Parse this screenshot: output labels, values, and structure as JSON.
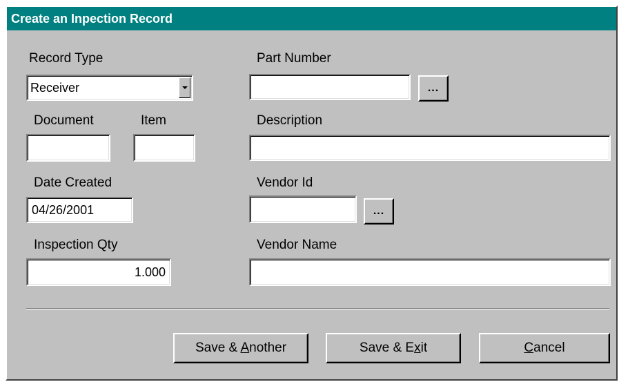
{
  "dialog": {
    "title": "Create an Inpection Record"
  },
  "labels": {
    "record_type": "Record Type",
    "part_number": "Part Number",
    "document": "Document",
    "item": "Item",
    "description": "Description",
    "date_created": "Date Created",
    "vendor_id": "Vendor Id",
    "inspection_qty": "Inspection Qty",
    "vendor_name": "Vendor Name"
  },
  "fields": {
    "record_type": {
      "value": "Receiver"
    },
    "part_number": {
      "value": ""
    },
    "document": {
      "value": ""
    },
    "item": {
      "value": ""
    },
    "description": {
      "value": ""
    },
    "date_created": {
      "value": "04/26/2001"
    },
    "vendor_id": {
      "value": ""
    },
    "inspection_qty": {
      "value": "1.000"
    },
    "vendor_name": {
      "value": ""
    }
  },
  "browse_button_label": "...",
  "buttons": {
    "save_another": {
      "before": "Save & ",
      "accel": "A",
      "after": "nother"
    },
    "save_exit": {
      "before": "Save & E",
      "accel": "x",
      "after": "it"
    },
    "cancel": {
      "before": "",
      "accel": "C",
      "after": "ancel"
    }
  },
  "icons": {
    "combo_dropdown": "chevron-down-icon"
  }
}
